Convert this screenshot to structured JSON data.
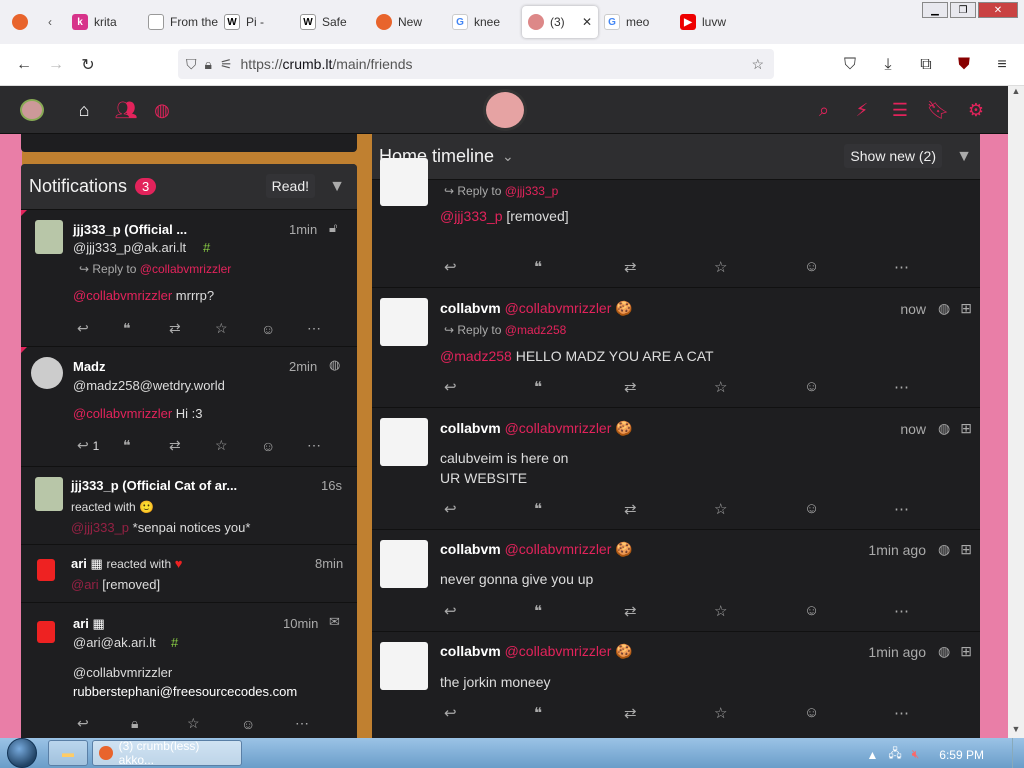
{
  "browser": {
    "tabs": [
      {
        "label": "",
        "icon": "firefox"
      },
      {
        "label": "krita",
        "icon": "k"
      },
      {
        "label": "From the",
        "icon": "page"
      },
      {
        "label": "Pi -",
        "icon": "W"
      },
      {
        "label": "Safe",
        "icon": "W"
      },
      {
        "label": "New",
        "icon": "firefox"
      },
      {
        "label": "knee",
        "icon": "G"
      },
      {
        "label": "(3)",
        "icon": "crumb",
        "active": true
      },
      {
        "label": "meo",
        "icon": "G"
      },
      {
        "label": "luvw",
        "icon": "youtube"
      }
    ],
    "url_scheme": "https://",
    "url_host": "crumb.lt",
    "url_path": "/main/friends"
  },
  "notifications": {
    "title": "Notifications",
    "count": "3",
    "read_label": "Read!",
    "items": [
      {
        "name": "jjj333_p (Official ...",
        "handle": "@jjj333_p@ak.ari.lt",
        "time": "1min",
        "reply_to_prefix": "Reply to",
        "reply_to": "@collabvmrizzler",
        "mention": "@collabvmrizzler",
        "text": "mrrrp?"
      },
      {
        "name": "Madz",
        "handle": "@madz258@wetdry.world",
        "time": "2min",
        "mention": "@collabvmrizzler",
        "text": "Hi :3",
        "reply_count": "1"
      },
      {
        "name": "jjj333_p (Official Cat of ar...",
        "time": "16s",
        "action": "reacted with",
        "handle": "@jjj333_p",
        "text": "*senpai notices you*"
      },
      {
        "name": "ari",
        "time": "8min",
        "action": "reacted with",
        "handle": "@ari",
        "text": "[removed]"
      },
      {
        "name": "ari",
        "handle": "@ari@ak.ari.lt",
        "time": "10min",
        "mention": "@collabvmrizzler",
        "text": "rubberstephani@freesourcecodes.com"
      }
    ]
  },
  "timeline": {
    "title": "Home timeline",
    "show_new": "Show new (2)",
    "posts": [
      {
        "reply_to_prefix": "Reply to",
        "reply_to": "@jjj333_p",
        "mention": "@jjj333_p",
        "text_line1": "[removed]",
        "text_line2": ""
      },
      {
        "name": "collabvm",
        "handle": "@collabvmrizzler",
        "time": "now",
        "reply_to_prefix": "Reply to",
        "reply_to": "@madz258",
        "mention": "@madz258",
        "text": "HELLO MADZ YOU ARE A CAT"
      },
      {
        "name": "collabvm",
        "handle": "@collabvmrizzler",
        "time": "now",
        "text_line1": "calubveim is here on",
        "text_line2": "UR WEBSITE"
      },
      {
        "name": "collabvm",
        "handle": "@collabvmrizzler",
        "time": "1min ago",
        "text": "never gonna give you up"
      },
      {
        "name": "collabvm",
        "handle": "@collabvmrizzler",
        "time": "1min ago",
        "text": "the jorkin moneey"
      }
    ]
  },
  "taskbar": {
    "task_label": "(3) crumb(less) akko...",
    "clock": "6:59 PM"
  },
  "colors": {
    "accent": "#e2235b",
    "panel": "#1e1e20",
    "header": "#2b2b2d"
  }
}
